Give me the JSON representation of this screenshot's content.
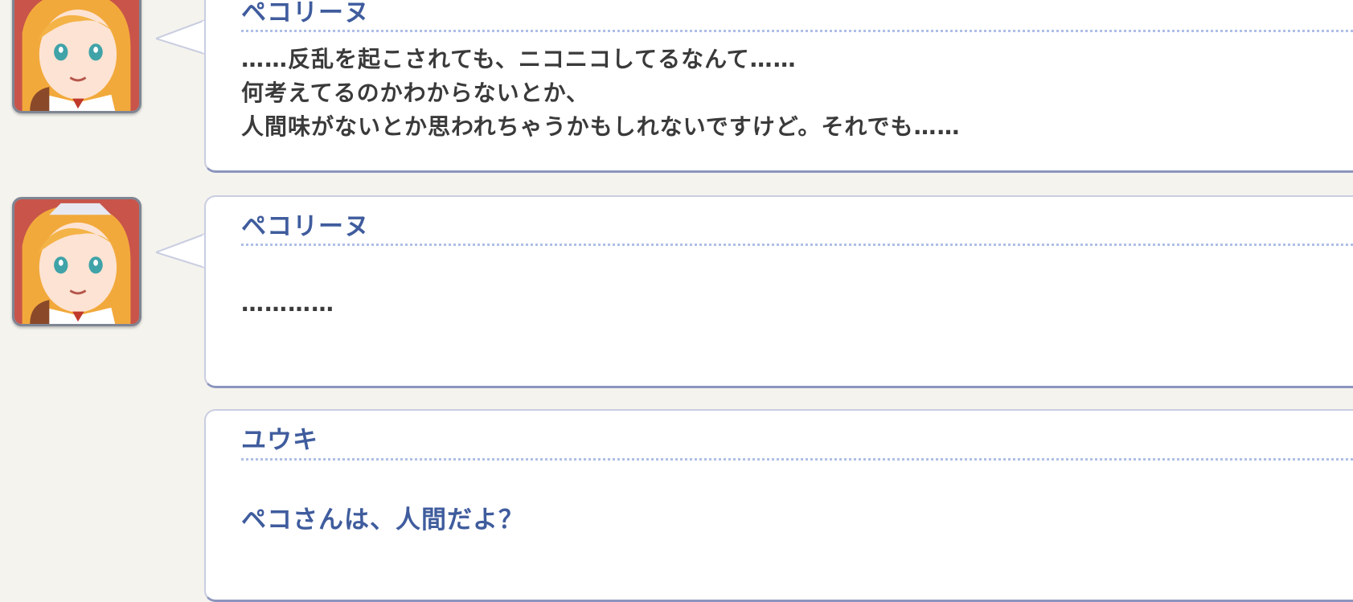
{
  "log": {
    "entries": [
      {
        "speaker": "ペコリーヌ",
        "lines": [
          "……反乱を起こされても、ニコニコしてるなんて……",
          "何考えてるのかわからないとか、",
          "人間味がないとか思われちゃうかもしれないですけど。それでも……"
        ],
        "has_avatar": true
      },
      {
        "speaker": "ペコリーヌ",
        "lines": [
          "…………"
        ],
        "has_avatar": true
      },
      {
        "speaker": "ユウキ",
        "lines": [
          "ペコさんは、人間だよ？"
        ],
        "has_avatar": false
      }
    ]
  },
  "colors": {
    "background": "#f4f3ee",
    "speaker_name": "#3f5c9d",
    "dialogue_text": "#3a3a3a",
    "player_text": "#3f5c9d",
    "bubble_border": "#8c95bd",
    "divider": "#aebfe6"
  },
  "icons": {
    "avatar": "character-portrait-icon",
    "bubble_tail": "speech-tail-icon"
  }
}
